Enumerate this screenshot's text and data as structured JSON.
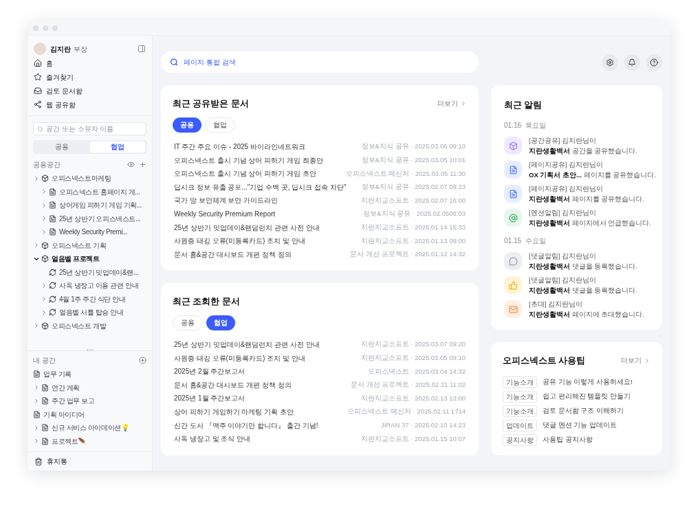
{
  "sidebar": {
    "user": {
      "name": "김지란",
      "title": "부장"
    },
    "nav": [
      {
        "label": "홈",
        "kind": "home"
      },
      {
        "label": "즐겨찾기",
        "kind": "star"
      },
      {
        "label": "검토 문서함",
        "kind": "inbox"
      },
      {
        "label": "웹 공유함",
        "kind": "share"
      }
    ],
    "search": {
      "placeholder": "공간 또는 소유자 이름"
    },
    "tabs": [
      {
        "label": "공용",
        "selected": false
      },
      {
        "label": "협업",
        "selected": true
      }
    ],
    "shared": {
      "label": "공용공간",
      "items": [
        {
          "label": "오피스넥스트마케팅",
          "kind": "space",
          "chevron": true,
          "expanded": false,
          "children": [
            {
              "label": "오피스넥스트 홈페이지 게...",
              "kind": "page",
              "chevron": true,
              "expanded": false
            },
            {
              "label": "상어게임 피하기 게임 기획...",
              "kind": "page",
              "chevron": true,
              "expanded": false
            },
            {
              "label": "25년 상반기 오피스넥스트...",
              "kind": "page",
              "chevron": true,
              "expanded": false
            },
            {
              "label": "Weekly Security Premi...",
              "kind": "page",
              "chevron": true,
              "expanded": false
            }
          ]
        },
        {
          "label": "오피스넥스트 기획",
          "kind": "space",
          "chevron": true,
          "expanded": false
        },
        {
          "label": "얼음벨 프로젝트",
          "kind": "space",
          "chevron": true,
          "expanded": true,
          "children": [
            {
              "label": "25년 상반기 밋업데이&랜...",
              "kind": "sync",
              "chevron": false,
              "expanded": false
            },
            {
              "label": "사옥 냉장고 이용 관련 안내",
              "kind": "sync",
              "chevron": true,
              "expanded": false
            },
            {
              "label": "4월 1주 주간 식단 안내",
              "kind": "sync",
              "chevron": true,
              "expanded": false
            },
            {
              "label": "얼음벨 서틀 탑승 안내",
              "kind": "sync",
              "chevron": true,
              "expanded": false
            }
          ]
        },
        {
          "label": "오피스넥스트 개발",
          "kind": "space",
          "chevron": true,
          "expanded": false
        }
      ]
    },
    "mine": {
      "label": "내 공간",
      "items": [
        {
          "label": "업무 기록",
          "kind": "page",
          "chevron": false,
          "expanded": false
        },
        {
          "label": "연간 계획",
          "kind": "page",
          "chevron": true,
          "expanded": false
        },
        {
          "label": "주간 업무 보고",
          "kind": "page",
          "chevron": true,
          "expanded": false
        },
        {
          "label": "기획 아이디어",
          "kind": "page",
          "chevron": false,
          "expanded": false
        },
        {
          "label": "신규 서비스 아이데이션💡",
          "kind": "page",
          "chevron": true,
          "expanded": false
        },
        {
          "label": "프로젝트🪶",
          "kind": "page",
          "chevron": true,
          "expanded": false
        }
      ]
    },
    "trash": {
      "label": "휴지통"
    }
  },
  "search": {
    "placeholder": "페이지 통합 검색"
  },
  "recent_shared": {
    "title": "최근 공유받은 문서",
    "more": "더보기",
    "filters": [
      {
        "label": "공용",
        "selected": true
      },
      {
        "label": "협업",
        "selected": false
      }
    ],
    "rows": [
      {
        "title": "IT 주간 주요 이슈 - 2025 바이라인네트워크",
        "meta": "정보&지식 공유 · 2025.03.06 09:10"
      },
      {
        "title": "오피스넥스트 출시 기념 상어 피하기 게임 최종안",
        "meta": "정보&지식 공유 · 2025.03.05 10:01"
      },
      {
        "title": "오피스넥스트 출시 기념 상어 피하기 게임 초안",
        "meta": "오피스넥스트 메신저 · 2025.03.05 11:30"
      },
      {
        "title": "딥시크 정보 유출 공포...\"기업 수백 곳, 딥시크 접속 차단\"",
        "meta": "정보&지식 공유 · 2025.02.07 09:23"
      },
      {
        "title": "국가 망 보안체계 보안 가이드라인",
        "meta": "지란지교소프트 · 2025.02.07 16:00"
      },
      {
        "title": "Weekly Security Premium Report",
        "meta": "정보&지식 공유 · 2025.02.0509:03"
      },
      {
        "title": "25년 상반기 밋업데이&랜덤런치 관련 사전 안내",
        "meta": "지란지교소프트 · 2025.01.14 15:33"
      },
      {
        "title": "사원증 태깅 오류(미등록카드) 조치 및 안내",
        "meta": "지란지교소프트 · 2025.01.13 09:00"
      },
      {
        "title": "문서 홈&공간 대시보드 개편 정책 정의",
        "meta": "문서 개선 프로젝트 · 2025.01.12 14:32"
      }
    ]
  },
  "recent_viewed": {
    "title": "최근 조회한 문서",
    "filters": [
      {
        "label": "공용",
        "selected": false
      },
      {
        "label": "협업",
        "selected": true
      }
    ],
    "rows": [
      {
        "title": "25년 상반기 밋업데이&랜덤런치 관련 사전 안내",
        "meta": "지란지교소프트 · 2025.03.07 09:20"
      },
      {
        "title": "사원증 태깅 오류(미등록카드) 조치 및 안내",
        "meta": "지란지교소프트 · 2025.03.05 09:10"
      },
      {
        "title": "2025년 2월 주간보고서",
        "meta": "오피스넥스트 · 2025.03.04 14:32"
      },
      {
        "title": "문서 홈&공간 대시보드 개편 정책 정의",
        "meta": "문서 개선 프로젝트 · 2025.02.21 11:02"
      },
      {
        "title": "2025년 1월 주간보고서",
        "meta": "지란지교소프트 · 2025.02.13 13:00"
      },
      {
        "title": "상어 피하기 게임하기 마케팅 기획 초안",
        "meta": "오피스넥스트 메신저 · 2025.02.11 1714"
      },
      {
        "title": "신간 도서 『맥주 이야기만 합니다』 출간 기념!",
        "meta": "JIRAN 37 · 2025.02.10 14:23"
      },
      {
        "title": "사옥 냉장고 및 조식 안내",
        "meta": "지란지교소프트 · 2025.01.15 10:07"
      }
    ]
  },
  "notifications": {
    "title": "최근 알림",
    "groups": [
      {
        "date": "01.16  목요일",
        "items": [
          {
            "kind": "space",
            "label": "[공간공유] 김지란님이",
            "message": "**지란생활백서** 공간을 공유했습니다."
          },
          {
            "kind": "page",
            "label": "[페이지공유] 김지란님이",
            "message": "**OX 기획서 초안...** 페이지를 공유했습니다."
          },
          {
            "kind": "page",
            "label": "[페이지공유] 김지란님이",
            "message": "**지란생활백서** 페이지를 공유했습니다."
          },
          {
            "kind": "mention",
            "label": "[멘션알림] 김지란님이",
            "message": "**지란생활백서** 페이지에서 언급했습니다."
          }
        ]
      },
      {
        "date": "01.15  수요일",
        "items": [
          {
            "kind": "comment",
            "label": "[댓글알림] 김지란님이",
            "message": "**지란생활백서** 댓글을 등록했습니다."
          },
          {
            "kind": "like",
            "label": "[댓글알림] 김지란님이",
            "message": "**지란생활백서** 댓글을 등록했습니다."
          },
          {
            "kind": "invite",
            "label": "[초대] 김지란님이",
            "message": "**지란생활백서** 페이지에 초대했습니다."
          }
        ]
      }
    ]
  },
  "tips": {
    "title": "오피스넥스트 사용팁",
    "more": "더보기",
    "items": [
      {
        "tag": "기능소개",
        "title": "공유 기능 이렇게 사용하세요!"
      },
      {
        "tag": "기능소개",
        "title": "쉽고 편리해진 템플릿 만들기"
      },
      {
        "tag": "기능소개",
        "title": "검토 문서함 구조 이해하기"
      },
      {
        "tag": "업데이트",
        "title": "댓글 멘션 기능 업데이트"
      },
      {
        "tag": "공지사항",
        "title": "사용팁 공지사항"
      }
    ]
  }
}
